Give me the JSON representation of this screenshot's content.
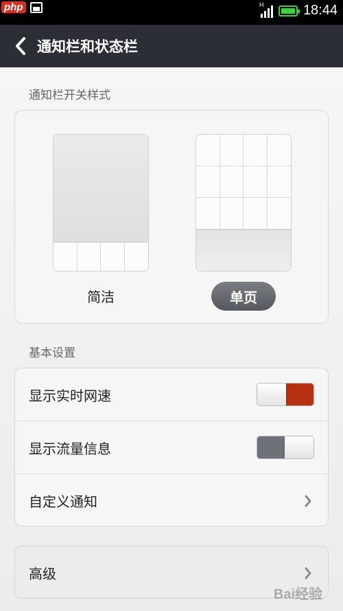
{
  "statusbar": {
    "badge": "php",
    "network_type": "H",
    "time": "18:44",
    "battery_color": "#3bd33b"
  },
  "header": {
    "title": "通知栏和状态栏",
    "back_icon": "chevron-left-icon"
  },
  "style_section": {
    "label": "通知栏开关样式",
    "options": [
      {
        "label": "简洁",
        "selected": false
      },
      {
        "label": "单页",
        "selected": true
      }
    ]
  },
  "basic_section": {
    "label": "基本设置",
    "rows": [
      {
        "label": "显示实时网速",
        "type": "toggle",
        "on": true,
        "on_color": "#b7300f"
      },
      {
        "label": "显示流量信息",
        "type": "toggle",
        "on": false,
        "off_color": "#6f7178"
      },
      {
        "label": "自定义通知",
        "type": "link"
      }
    ]
  },
  "advanced": {
    "label": "高级"
  },
  "watermark": "Bai经验"
}
